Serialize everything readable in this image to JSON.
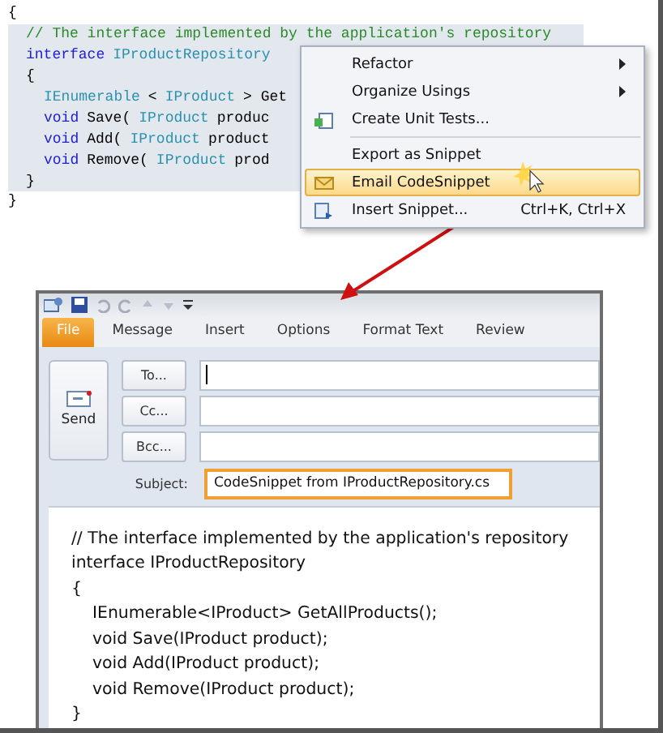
{
  "editor": {
    "lines": [
      {
        "tokens": [
          {
            "kind": "plain",
            "text": "{"
          }
        ],
        "children": [
          {
            "tokens": [
              {
                "kind": "comment",
                "text": "// The interface implemented by the application's repository"
              }
            ]
          },
          {
            "tokens": [
              {
                "kind": "keyword",
                "text": "interface"
              },
              {
                "kind": "type",
                "text": "IProductRepository"
              }
            ]
          },
          {
            "tokens": [
              {
                "kind": "plain",
                "text": "{"
              }
            ],
            "children": [
              {
                "tokens": [
                  {
                    "kind": "type",
                    "text": "IEnumerable"
                  },
                  {
                    "kind": "plain",
                    "text": "<"
                  },
                  {
                    "kind": "type",
                    "text": "IProduct"
                  },
                  {
                    "kind": "plain",
                    "text": "> Get"
                  }
                ]
              },
              {
                "tokens": [
                  {
                    "kind": "keyword",
                    "text": "void"
                  },
                  {
                    "kind": "plain",
                    "text": "Save("
                  },
                  {
                    "kind": "type",
                    "text": "IProduct"
                  },
                  {
                    "kind": "plain",
                    "text": "produc"
                  }
                ]
              },
              {
                "tokens": [
                  {
                    "kind": "keyword",
                    "text": "void"
                  },
                  {
                    "kind": "plain",
                    "text": "Add("
                  },
                  {
                    "kind": "type",
                    "text": "IProduct"
                  },
                  {
                    "kind": "plain",
                    "text": "product"
                  }
                ]
              },
              {
                "tokens": [
                  {
                    "kind": "keyword",
                    "text": "void"
                  },
                  {
                    "kind": "plain",
                    "text": "Remove("
                  },
                  {
                    "kind": "type",
                    "text": "IProduct"
                  },
                  {
                    "kind": "plain",
                    "text": "prod"
                  }
                ]
              }
            ]
          },
          {
            "tokens": [
              {
                "kind": "plain",
                "text": "}"
              }
            ]
          }
        ]
      },
      {
        "tokens": [
          {
            "kind": "plain",
            "text": "}"
          }
        ]
      }
    ]
  },
  "context_menu": {
    "items": [
      {
        "kind": "item",
        "label": "Refactor",
        "submenu": true,
        "selected": false
      },
      {
        "kind": "item",
        "label": "Organize Usings",
        "submenu": true,
        "selected": false
      },
      {
        "kind": "item",
        "label": "Create Unit Tests...",
        "submenu": false,
        "selected": false
      },
      {
        "kind": "separator"
      },
      {
        "kind": "item",
        "label": "Export as Snippet",
        "submenu": false,
        "selected": false
      },
      {
        "kind": "item",
        "label": "Email CodeSnippet",
        "submenu": false,
        "selected": true
      },
      {
        "kind": "item",
        "label": "Insert Snippet...",
        "shortcut": "Ctrl+K, Ctrl+X",
        "submenu": false,
        "selected": false
      }
    ]
  },
  "mail_window": {
    "tabs": [
      {
        "label": "File",
        "selected": true
      },
      {
        "label": "Message",
        "selected": false
      },
      {
        "label": "Insert",
        "selected": false
      },
      {
        "label": "Options",
        "selected": false
      },
      {
        "label": "Format Text",
        "selected": false
      },
      {
        "label": "Review",
        "selected": false
      }
    ],
    "send_button": "Send",
    "address_rows": [
      {
        "button": "To...",
        "focused": true
      },
      {
        "button": "Cc...",
        "focused": false
      },
      {
        "button": "Bcc...",
        "focused": false
      }
    ],
    "subject": {
      "label": "Subject:",
      "value": "CodeSnippet from IProductRepository.cs",
      "highlighted": true
    },
    "body": [
      {
        "text": "// The interface implemented by the application's repository"
      },
      {
        "text": "interface IProductRepository"
      },
      {
        "text": "{",
        "children": [
          {
            "text": "IEnumerable<IProduct> GetAllProducts();"
          },
          {
            "text": "void Save(IProduct product);"
          },
          {
            "text": "void Add(IProduct product);"
          },
          {
            "text": "void Remove(IProduct product);"
          }
        ]
      },
      {
        "text": "}"
      }
    ]
  }
}
